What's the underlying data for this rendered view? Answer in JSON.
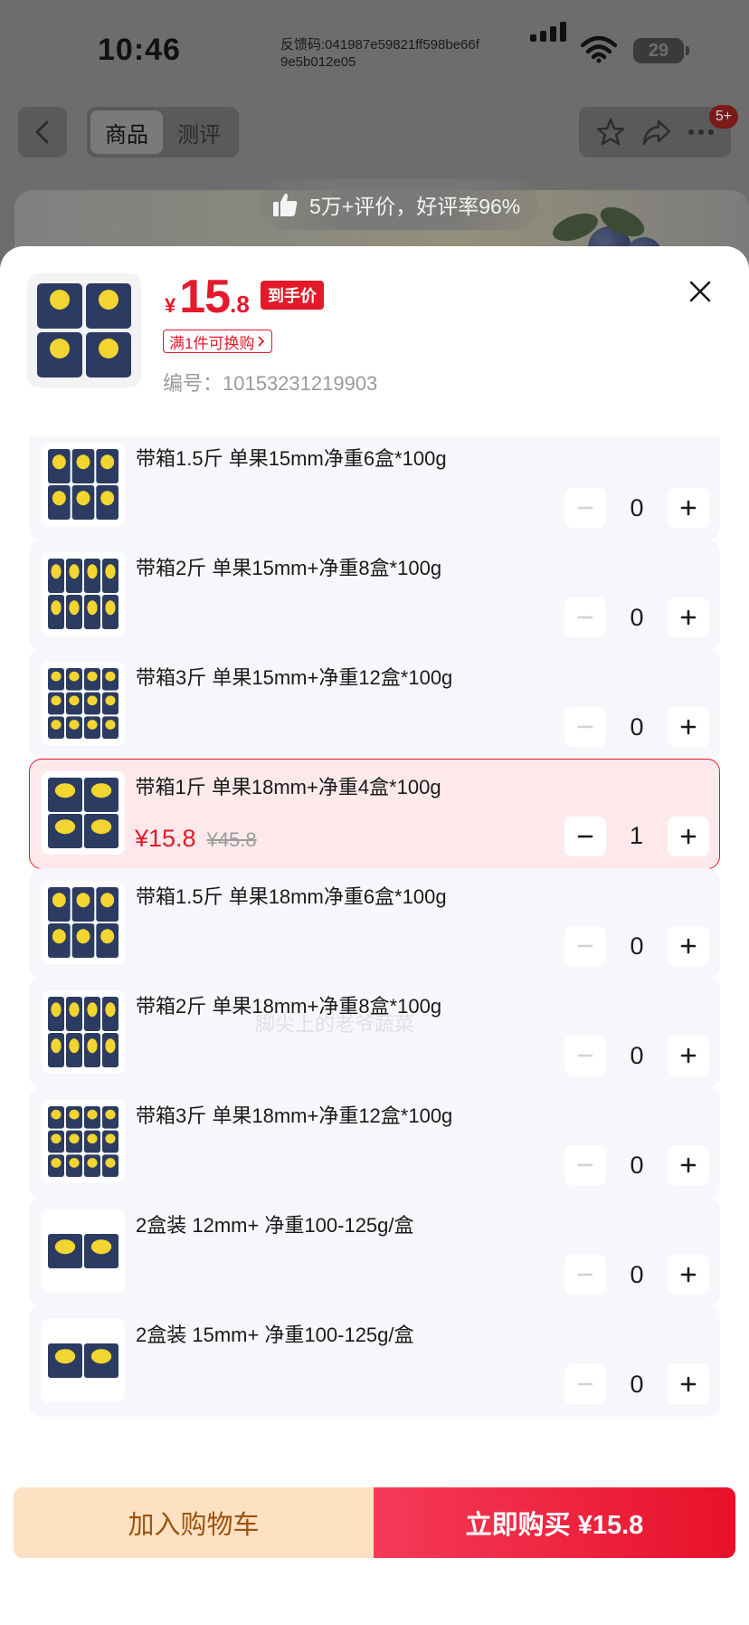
{
  "status_bar": {
    "time": "10:46",
    "feedback": "反馈码:041987e59821ff598be66f9e5b012e05",
    "battery": "29"
  },
  "nav": {
    "tabs": [
      {
        "label": "商品",
        "active": true
      },
      {
        "label": "测评",
        "active": false
      }
    ],
    "badge": "5+"
  },
  "review_summary": "5万+评价，好评率96%",
  "sheet": {
    "price": {
      "currency": "¥",
      "integer": "15",
      "decimal": ".8"
    },
    "deal_tag": "到手价",
    "swap_tag": "满1件可换购",
    "sku_code": "编号：10153231219903"
  },
  "variants": [
    {
      "title": "带箱1.5斤 单果15mm净重6盒*100g",
      "qty": "0",
      "boxes": 6
    },
    {
      "title": "带箱2斤 单果15mm+净重8盒*100g",
      "qty": "0",
      "boxes": 8
    },
    {
      "title": "带箱3斤 单果15mm+净重12盒*100g",
      "qty": "0",
      "boxes": 12
    },
    {
      "title": "带箱1斤 单果18mm+净重4盒*100g",
      "qty": "1",
      "boxes": 4,
      "selected": true,
      "price": "¥15.8",
      "original_price": "¥45.8"
    },
    {
      "title": "带箱1.5斤 单果18mm净重6盒*100g",
      "qty": "0",
      "boxes": 6
    },
    {
      "title": "带箱2斤 单果18mm+净重8盒*100g",
      "qty": "0",
      "boxes": 8
    },
    {
      "title": "带箱3斤 单果18mm+净重12盒*100g",
      "qty": "0",
      "boxes": 12
    },
    {
      "title": "2盒装 12mm+ 净重100-125g/盒",
      "qty": "0",
      "boxes": 2
    },
    {
      "title": "2盒装 15mm+ 净重100-125g/盒",
      "qty": "0",
      "boxes": 2
    }
  ],
  "watermark": "脚尖上的老爷蔬菜",
  "bottom": {
    "add_to_cart": "加入购物车",
    "buy_now": "立即购买 ¥15.8"
  },
  "colors": {
    "accent_red": "#e4192a",
    "cart_bg": "#fde1c2",
    "cart_text": "#a0520e"
  }
}
